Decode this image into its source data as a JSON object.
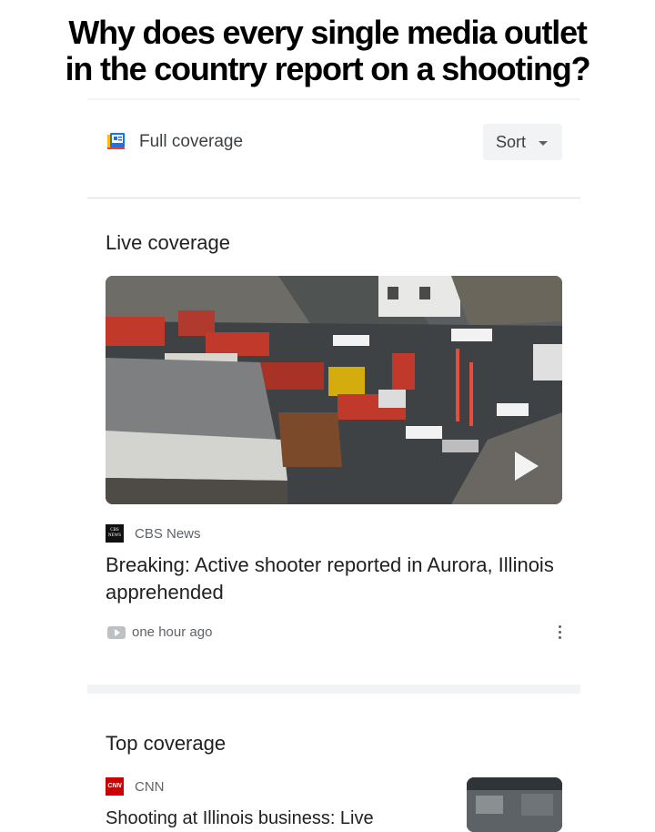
{
  "caption": {
    "line1": "Why does every single media outlet",
    "line2": "in the country report on a shooting?"
  },
  "header": {
    "full_coverage_label": "Full coverage",
    "full_coverage_icon": "newspaper-icon",
    "sort_label": "Sort"
  },
  "live": {
    "section_title": "Live coverage",
    "source": "CBS News",
    "source_logo": "CBS NEWS",
    "headline": "Breaking: Active shooter reported in Aurora, Illinois apprehended",
    "time": "one hour ago",
    "thumbnail_icon": "play-icon"
  },
  "top": {
    "section_title": "Top coverage",
    "source": "CNN",
    "source_logo": "CNN",
    "headline": "Shooting at Illinois business: Live"
  },
  "colors": {
    "accent_blue": "#1a73e8",
    "cnn_red": "#cc0000",
    "text_primary": "#202124",
    "text_secondary": "#5f6368"
  }
}
